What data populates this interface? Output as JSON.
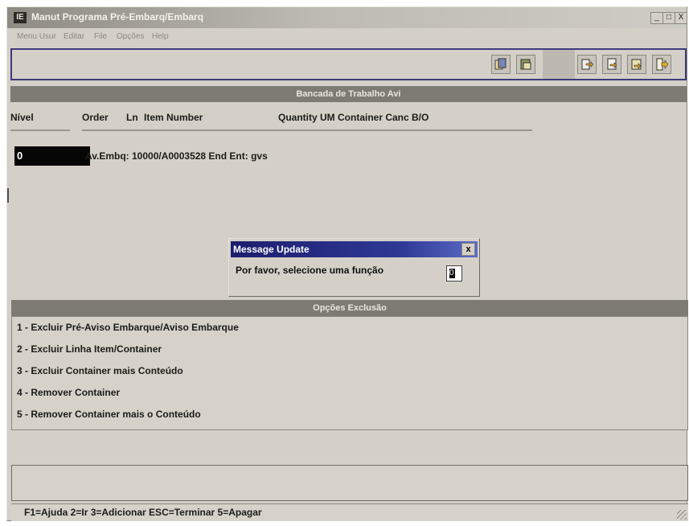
{
  "window": {
    "title": "Manut Programa Pré-Embarq/Embarq",
    "app_icon": "IE",
    "controls": {
      "minimize": "_",
      "maximize": "□",
      "close": "X"
    }
  },
  "menu": [
    "Menu Usur",
    "Editar",
    "File",
    "Opções",
    "Help"
  ],
  "toolbar": {
    "icons": [
      "copy-doc-icon",
      "paste-doc-icon",
      "arrow-right-doc-icon",
      "doc-forward-icon",
      "doc-next-icon",
      "exit-door-icon"
    ]
  },
  "work_area": {
    "header": "Bancada de Trabalho Avi",
    "columns": {
      "nivel": "Nível",
      "order": "Order",
      "ln": "Ln",
      "item_number": "Item Number",
      "qty_group": "Quantity UM Container Canc B/O"
    },
    "nivel_value": "0",
    "record": "Av.Embq: 10000/A0003528  End Ent: gvs"
  },
  "dialog": {
    "title": "Message Update",
    "close": "x",
    "prompt": "Por favor, selecione uma função",
    "input_value": "0"
  },
  "options": {
    "header": "Opções Exclusão",
    "items": [
      "1 - Excluir Pré-Aviso Embarque/Aviso Embarque",
      "2 - Excluir Linha Item/Container",
      "3 - Excluir Container mais Conteúdo",
      "4 - Remover Container",
      "5 - Remover Container mais o Conteúdo"
    ]
  },
  "status_bar": {
    "text": "F1=Ajuda 2=Ir 3=Adicionar ESC=Terminar 5=Apagar"
  },
  "colors": {
    "window_bg": "#d4d0c8",
    "section_bar": "#7e7b74",
    "dialog_title": "#1c1d6e",
    "toolbar_border": "#3c3a7c"
  }
}
